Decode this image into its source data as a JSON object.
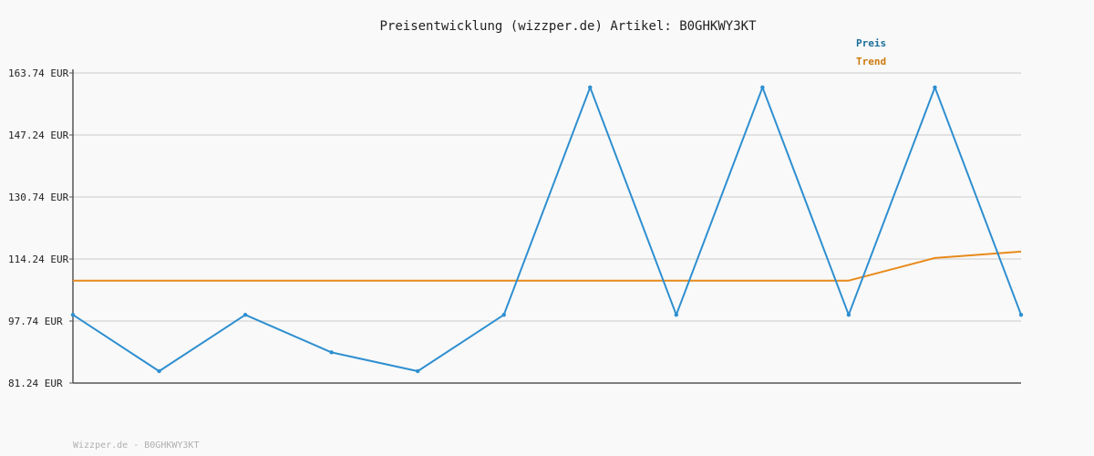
{
  "chart_data": {
    "type": "line",
    "title": "Preisentwicklung (wizzper.de) Artikel: B0GHKWY3KT",
    "xlabel": "",
    "ylabel": "",
    "ylim": [
      81.24,
      163.74
    ],
    "yticks": [
      "163.74 EUR",
      "147.24 EUR",
      "130.74 EUR",
      "114.24 EUR",
      "97.74 EUR",
      "81.24 EUR"
    ],
    "ytick_values": [
      163.74,
      147.24,
      130.74,
      114.24,
      97.74,
      81.24
    ],
    "grid": true,
    "legend_position": "top-right",
    "x": [
      0,
      1,
      2,
      3,
      4,
      5,
      6,
      7,
      8,
      9,
      10,
      11
    ],
    "series": [
      {
        "name": "Preis",
        "color": "#2e8fd0",
        "values": [
          99.4,
          84.4,
          99.4,
          89.4,
          84.4,
          99.4,
          159.9,
          99.4,
          159.9,
          99.4,
          159.9,
          99.4
        ]
      },
      {
        "name": "Trend",
        "color": "#e88a1a",
        "values": [
          108.5,
          108.5,
          108.5,
          108.5,
          108.5,
          108.5,
          108.5,
          108.5,
          108.5,
          108.5,
          114.5,
          116.2
        ]
      }
    ]
  },
  "legend": {
    "preis_label": "Preis",
    "preis_color": "#1a6e99",
    "trend_label": "Trend",
    "trend_color": "#cc7a10"
  },
  "footer": {
    "text": "Wizzper.de - B0GHKWY3KT"
  }
}
